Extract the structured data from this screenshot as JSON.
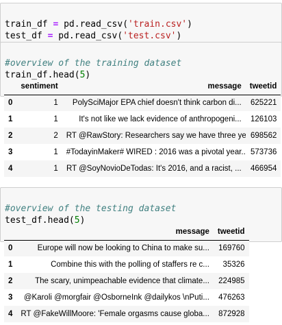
{
  "cell1": {
    "lines": [
      {
        "lhs": "train_df",
        "op": "=",
        "call": "pd.read_csv(",
        "arg": "'train.csv'",
        "close": ")"
      },
      {
        "lhs": "test_df",
        "op": "=",
        "call": "pd.read_csv(",
        "arg": "'test.csv'",
        "close": ")"
      }
    ]
  },
  "cell2": {
    "comment": "#overview of the training dataset",
    "call": "train_df.head(",
    "arg": "5",
    "close": ")"
  },
  "train_table": {
    "columns": [
      "sentiment",
      "message",
      "tweetid"
    ],
    "rows": [
      {
        "index": "0",
        "sentiment": "1",
        "message": "PolySciMajor EPA chief doesn't think carbon di...",
        "tweetid": "625221"
      },
      {
        "index": "1",
        "sentiment": "1",
        "message": "It's not like we lack evidence of anthropogeni...",
        "tweetid": "126103"
      },
      {
        "index": "2",
        "sentiment": "2",
        "message": "RT @RawStory: Researchers say we have three ye...",
        "tweetid": "698562"
      },
      {
        "index": "3",
        "sentiment": "1",
        "message": "#TodayinMaker# WIRED : 2016 was a pivotal year...",
        "tweetid": "573736"
      },
      {
        "index": "4",
        "sentiment": "1",
        "message": "RT @SoyNovioDeTodas: It's 2016, and a racist, ...",
        "tweetid": "466954"
      }
    ]
  },
  "cell3": {
    "comment": "#overview of the testing dataset",
    "call": "test_df.head(",
    "arg": "5",
    "close": ")"
  },
  "test_table": {
    "columns": [
      "message",
      "tweetid"
    ],
    "rows": [
      {
        "index": "0",
        "message": "Europe will now be looking to China to make su...",
        "tweetid": "169760"
      },
      {
        "index": "1",
        "message": "Combine this with the polling of staffers re c...",
        "tweetid": "35326"
      },
      {
        "index": "2",
        "message": "The scary, unimpeachable evidence that climate...",
        "tweetid": "224985"
      },
      {
        "index": "3",
        "message": "@Karoli @morgfair @OsborneInk @dailykos \\nPuti...",
        "tweetid": "476263"
      },
      {
        "index": "4",
        "message": "RT @FakeWillMoore: 'Female orgasms cause globa...",
        "tweetid": "872928"
      }
    ]
  }
}
